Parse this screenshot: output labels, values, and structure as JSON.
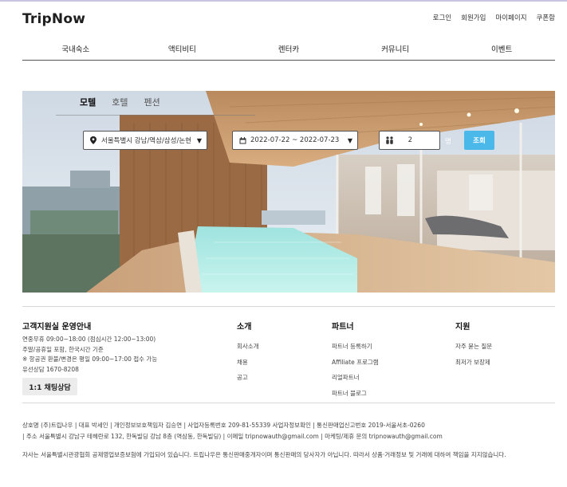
{
  "header": {
    "logo": "TripNow",
    "util_links": [
      "로그인",
      "회원가입",
      "마이페이지",
      "쿠폰함"
    ]
  },
  "nav": {
    "items": [
      "국내숙소",
      "액티비티",
      "렌터카",
      "커뮤니티",
      "이벤트"
    ]
  },
  "search": {
    "tabs": [
      "모텔",
      "호텔",
      "펜션"
    ],
    "active_tab": "모텔",
    "location": "서울특별시 강남/역삼/삼성/논현",
    "dates": "2022-07-22 ~ 2022-07-23",
    "guests": "2",
    "guest_unit": "명",
    "submit_label": "조회",
    "accent_color": "#4bb8ea"
  },
  "footer": {
    "support_title": "고객지원실 운영안내",
    "support_lines": [
      "연중무휴 09:00~18:00 (점심시간 12:00~13:00)",
      "주말/공휴일 포함, 한국시간 기준",
      "※ 항공권 환불/변경은 평일 09:00~17:00 접수 가능",
      "유선상담 1670-8208"
    ],
    "chat_button": "1:1 채팅상담",
    "about_title": "소개",
    "about_links": [
      "회사소개",
      "채용",
      "공고"
    ],
    "partner_title": "파트너",
    "partner_links": [
      "파트너 등록하기",
      "Affiliate 프로그램",
      "리얼파트너",
      "파트너 블로그"
    ],
    "help_title": "지원",
    "help_links": [
      "자주 묻는 질문",
      "최저가 보장제"
    ],
    "business_line1": "상호명 (주)트립나우 | 대표 박세인 | 개인정보보호책임자 김승연 | 사업자등록번호 209-81-55339 사업자정보확인 | 통신판매업신고번호 2019-서울서초-0260",
    "business_line2": "| 주소 서울특별시 강남구 테헤란로 132, 한독빌딩 강남 8층 (역삼동, 한독빌딩) | 이메일 tripnowauth@gmail.com | 마케팅/제휴 문의 tripnowauth@gmail.com",
    "disclaimer": "자사는 서울특별시관광협회 공제영업보증보험에 가입되어 있습니다. 트립나우은 통신판매중개자이며 통신판매의 당사자가 아닙니다. 따라서 상품·거래정보 및 거래에 대하여 책임을 지지않습니다."
  }
}
